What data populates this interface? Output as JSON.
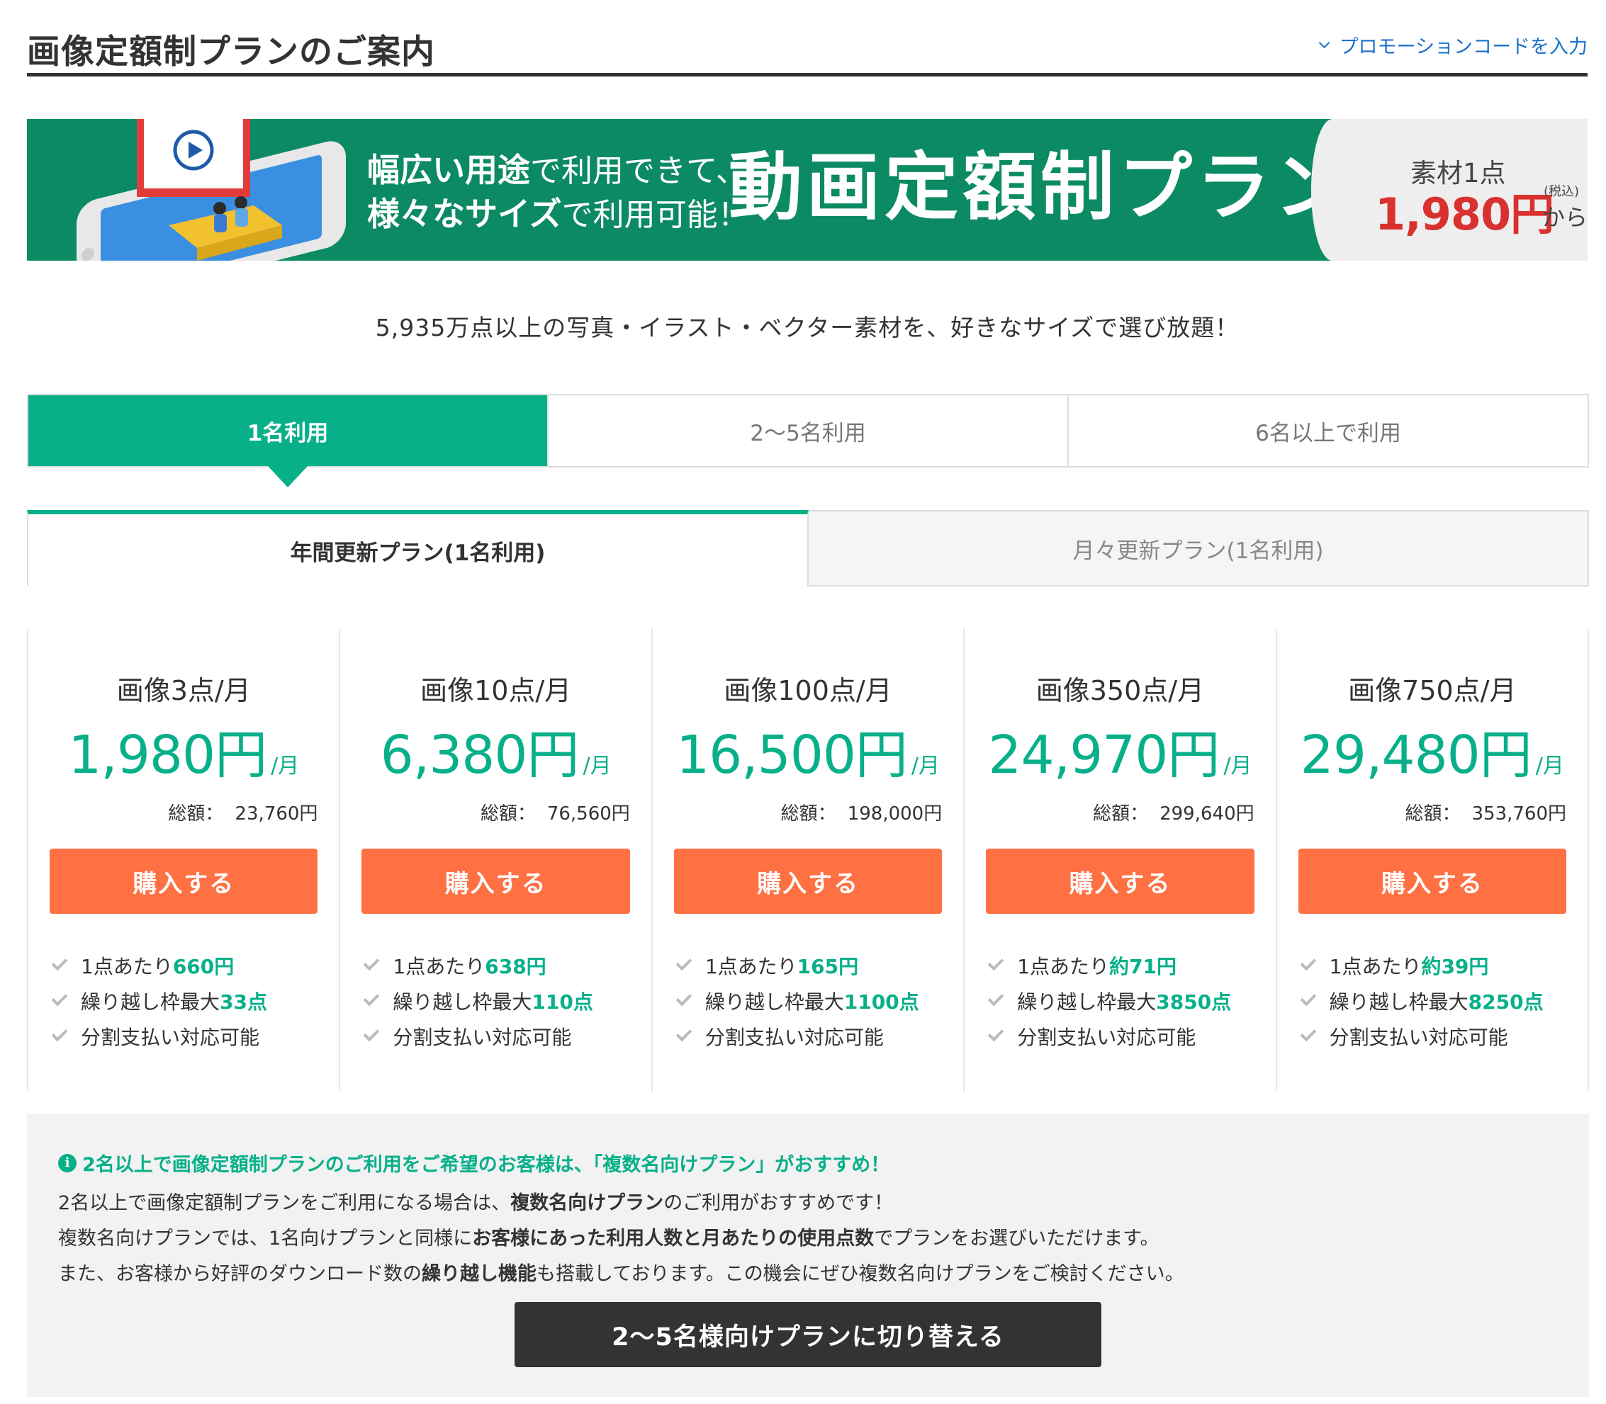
{
  "header": {
    "title": "画像定額制プランのご案内",
    "promo_link": "プロモーションコードを入力"
  },
  "banner": {
    "sub_line1_bold": "幅広い用途",
    "sub_line1_rest": "で利用できて、",
    "sub_line2_bold": "様々なサイズ",
    "sub_line2_rest": "で利用可能！",
    "main_title": "動画定額制プラン",
    "price_label": "素材1点",
    "price": "1,980円",
    "price_note": "(税込)",
    "price_from": "から"
  },
  "intro": "5,935万点以上の写真・イラスト・ベクター素材を、好きなサイズで選び放題！",
  "user_tabs": [
    {
      "label": "1名利用",
      "active": true
    },
    {
      "label": "2〜5名利用",
      "active": false
    },
    {
      "label": "6名以上で利用",
      "active": false
    }
  ],
  "billing_tabs": [
    {
      "label": "年間更新プラン(1名利用)",
      "active": true
    },
    {
      "label": "月々更新プラン(1名利用)",
      "active": false
    }
  ],
  "plans": [
    {
      "name": "画像3点/月",
      "price": "1,980円",
      "per": "/月",
      "total_label": "総額：",
      "total": "23,760円",
      "buy": "購入する",
      "f1_pre": "1点あたり",
      "f1_val": "660円",
      "f2_pre": "繰り越し枠最大",
      "f2_val": "33点",
      "f3": "分割支払い対応可能"
    },
    {
      "name": "画像10点/月",
      "price": "6,380円",
      "per": "/月",
      "total_label": "総額：",
      "total": "76,560円",
      "buy": "購入する",
      "f1_pre": "1点あたり",
      "f1_val": "638円",
      "f2_pre": "繰り越し枠最大",
      "f2_val": "110点",
      "f3": "分割支払い対応可能"
    },
    {
      "name": "画像100点/月",
      "price": "16,500円",
      "per": "/月",
      "total_label": "総額：",
      "total": "198,000円",
      "buy": "購入する",
      "f1_pre": "1点あたり",
      "f1_val": "165円",
      "f2_pre": "繰り越し枠最大",
      "f2_val": "1100点",
      "f3": "分割支払い対応可能"
    },
    {
      "name": "画像350点/月",
      "price": "24,970円",
      "per": "/月",
      "total_label": "総額：",
      "total": "299,640円",
      "buy": "購入する",
      "f1_pre": "1点あたり",
      "f1_val": "約71円",
      "f2_pre": "繰り越し枠最大",
      "f2_val": "3850点",
      "f3": "分割支払い対応可能"
    },
    {
      "name": "画像750点/月",
      "price": "29,480円",
      "per": "/月",
      "total_label": "総額：",
      "total": "353,760円",
      "buy": "購入する",
      "f1_pre": "1点あたり",
      "f1_val": "約39円",
      "f2_pre": "繰り越し枠最大",
      "f2_val": "8250点",
      "f3": "分割支払い対応可能"
    }
  ],
  "info": {
    "icon": "i",
    "heading": "2名以上で画像定額制プランのご利用をご希望のお客様は、「複数名向けプラン」がおすすめ！",
    "line1_a": "2名以上で画像定額制プランをご利用になる場合は、",
    "line1_b": "複数名向けプラン",
    "line1_c": "のご利用がおすすめです！",
    "line2_a": "複数名向けプランでは、1名向けプランと同様に",
    "line2_b": "お客様にあった利用人数と月あたりの使用点数",
    "line2_c": "でプランをお選びいただけます。",
    "line3_a": "また、お客様から好評のダウンロード数の",
    "line3_b": "繰り越し機能",
    "line3_c": "も搭載しております。この機会にぜひ複数名向けプランをご検討ください。",
    "switch_button": "2〜5名様向けプランに切り替える"
  },
  "colors": {
    "accent": "#08b08a",
    "banner_bg": "#0c8a64",
    "buy_button": "#ff7043",
    "banner_price": "#d9312f",
    "link": "#1a6fc9"
  }
}
